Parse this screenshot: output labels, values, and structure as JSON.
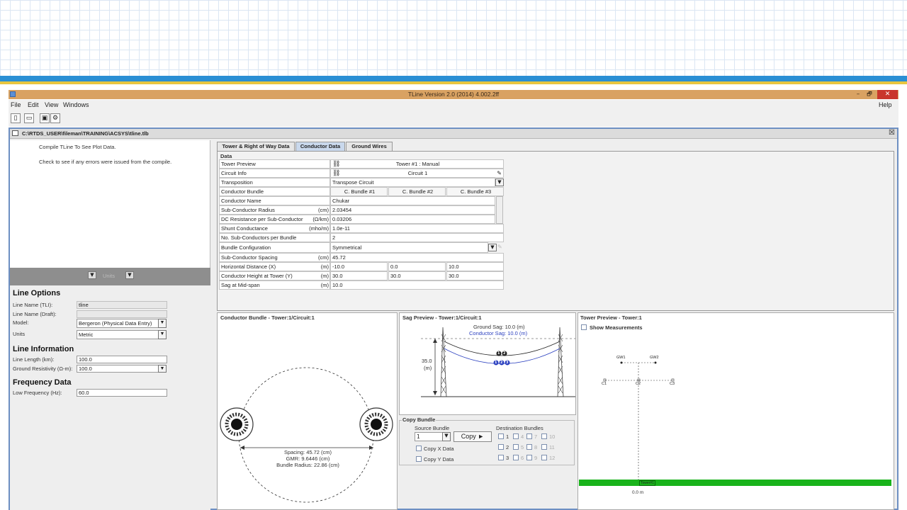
{
  "window": {
    "title": "TLine Version 2.0 (2014) 4.002.2ff",
    "minimize_glyph": "–",
    "maximize_glyph": "🗗",
    "close_glyph": "✕"
  },
  "menu": {
    "file": "File",
    "edit": "Edit",
    "view": "View",
    "windows": "Windows",
    "help": "Help"
  },
  "toolbar_icons": [
    "new-file-icon",
    "open-folder-icon",
    "save-icon",
    "compile-icon"
  ],
  "document": {
    "path": "C:\\RTDS_USER\\fileman\\TRAINING\\ACSYS\\tline.tlb",
    "close_glyph": "☒"
  },
  "left_panel": {
    "messages": [
      "Compile TLine To See Plot Data.",
      "Check to see if any errors were issued from the compile."
    ],
    "units_label": "Units"
  },
  "line_options": {
    "heading": "Line Options",
    "name_tli_label": "Line Name (TLI):",
    "name_tli_value": "tline",
    "name_draft_label": "Line Name (Draft):",
    "name_draft_value": "",
    "model_label": "Model:",
    "model_value": "Bergeron (Physical Data Entry)",
    "units_label": "Units",
    "units_value": "Metric"
  },
  "line_information": {
    "heading": "Line Information",
    "length_label": "Line Length (km):",
    "length_value": "100.0",
    "resistivity_label": "Ground Resistivity (Ω-m):",
    "resistivity_value": "100.0"
  },
  "frequency_data": {
    "heading": "Frequency Data",
    "low_freq_label": "Low Frequency (Hz):",
    "low_freq_value": "60.0"
  },
  "tabs": [
    "Tower & Right of Way Data",
    "Conductor Data",
    "Ground Wires"
  ],
  "data_grid": {
    "heading": "Data",
    "rows": [
      {
        "label": "Tower Preview",
        "unit": "",
        "value": "Tower #1 : Manual"
      },
      {
        "label": "Circuit Info",
        "unit": "",
        "value": "Circuit 1"
      },
      {
        "label": "Transposition",
        "unit": "",
        "value": "Transpose Circuit"
      },
      {
        "label": "Conductor Bundle",
        "unit": "",
        "values": [
          "C. Bundle #1",
          "C. Bundle #2",
          "C. Bundle #3"
        ]
      },
      {
        "label": "Conductor Name",
        "unit": "",
        "value": "Chukar"
      },
      {
        "label": "Sub-Conductor Radius",
        "unit": "(cm)",
        "value": "2.03454"
      },
      {
        "label": "DC Resistance per Sub-Conductor",
        "unit": "(Ω/km)",
        "value": "0.03206"
      },
      {
        "label": "Shunt Conductance",
        "unit": "(mho/m)",
        "value": "1.0e-11"
      },
      {
        "label": "No. Sub-Conductors per Bundle",
        "unit": "",
        "value": "2"
      },
      {
        "label": "Bundle Configuration",
        "unit": "",
        "value": "Symmetrical"
      },
      {
        "label": "Sub-Conductor Spacing",
        "unit": "(cm)",
        "value": "45.72"
      },
      {
        "label": "Horizontal Distance (X)",
        "unit": "(m)",
        "values": [
          "-10.0",
          "0.0",
          "10.0"
        ]
      },
      {
        "label": "Conductor Height at Tower (Y)",
        "unit": "(m)",
        "values": [
          "30.0",
          "30.0",
          "30.0"
        ]
      },
      {
        "label": "Sag at Mid-span",
        "unit": "(m)",
        "value": "10.0"
      }
    ]
  },
  "conductor_bundle_panel": {
    "title": "Conductor Bundle - Tower:1/Circuit:1",
    "spacing": "Spacing: 45.72 (cm)",
    "gmr": "GMR: 9.6446 (cm)",
    "bundle_radius": "Bundle Radius: 22.86 (cm)"
  },
  "sag_panel": {
    "title": "Sag Preview - Tower:1/Circuit:1",
    "ground_sag": "Ground Sag: 10.0 (m)",
    "conductor_sag": "Conductor Sag: 10.0 (m)",
    "height_value": "35.0",
    "height_unit": "(m)",
    "ground_wire_labels": [
      "1",
      "2"
    ],
    "conductor_labels": [
      "1",
      "2",
      "3"
    ],
    "ground_color": "#222222",
    "conductor_color": "#2a3fbf"
  },
  "copy_bundle": {
    "title": "Copy Bundle",
    "source_label": "Source Bundle",
    "source_value": "1",
    "copy_button": "Copy ►",
    "copy_x": "Copy X Data",
    "copy_y": "Copy Y Data",
    "dest_label": "Destination Bundles",
    "dest_rows": [
      [
        "1",
        "4",
        "7",
        "10"
      ],
      [
        "2",
        "5",
        "8",
        "11"
      ],
      [
        "3",
        "6",
        "9",
        "12"
      ]
    ]
  },
  "tower_panel": {
    "title": "Tower Preview - Tower:1",
    "show_measurements": "Show Measurements",
    "gw_labels": [
      "GW1",
      "GW2"
    ],
    "conductor_labels": [
      "C1",
      "C2",
      "C3"
    ],
    "tower_tag": "Tower#1",
    "distance": "0.0 m",
    "ground_color": "#19b31b"
  }
}
